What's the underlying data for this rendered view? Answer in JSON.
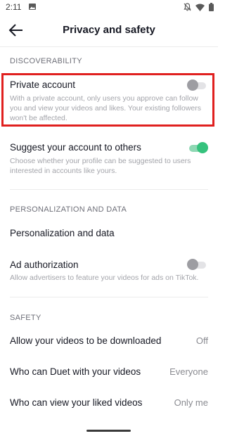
{
  "status_bar": {
    "time": "2:11",
    "icons": [
      "image-icon",
      "bell-off-icon",
      "wifi-icon",
      "battery-icon"
    ]
  },
  "header": {
    "title": "Privacy and safety",
    "back_icon": "arrow-left-icon"
  },
  "discoverability": {
    "section_title": "DISCOVERABILITY",
    "private_account": {
      "title": "Private account",
      "description": "With a private account, only users you approve can follow you and view your videos and likes. Your existing followers won't be affected.",
      "toggle_on": false
    },
    "suggest_account": {
      "title": "Suggest your account to others",
      "description": "Choose whether your profile can be suggested to users interested in accounts like yours.",
      "toggle_on": true
    }
  },
  "personalization": {
    "section_title": "PERSONALIZATION AND DATA",
    "personalization_data": {
      "title": "Personalization and data"
    },
    "ad_authorization": {
      "title": "Ad authorization",
      "description": "Allow advertisers to feature your videos for ads on TikTok.",
      "toggle_on": false
    }
  },
  "safety": {
    "section_title": "SAFETY",
    "items": [
      {
        "title": "Allow your videos to be downloaded",
        "value": "Off"
      },
      {
        "title": "Who can Duet with your videos",
        "value": "Everyone"
      },
      {
        "title": "Who can view your liked videos",
        "value": "Only me"
      }
    ]
  },
  "colors": {
    "accent_green": "#35c27d",
    "highlight_red": "#e0201f",
    "text_primary": "#161823",
    "text_secondary": "#a3a4aa"
  }
}
